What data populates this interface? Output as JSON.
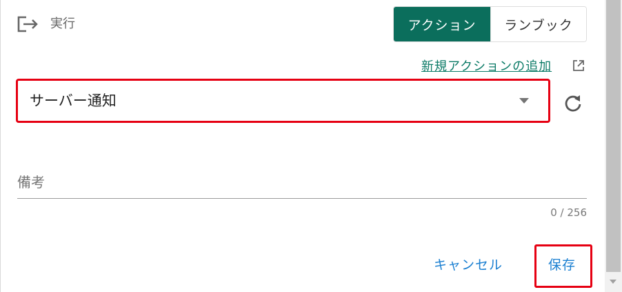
{
  "header": {
    "exec_label": "実行",
    "tabs": [
      {
        "label": "アクション",
        "active": true
      },
      {
        "label": "ランブック",
        "active": false
      }
    ]
  },
  "add_action_link": "新規アクションの追加",
  "action_select": {
    "value": "サーバー通知"
  },
  "remarks": {
    "label": "備考",
    "counter": "0 / 256"
  },
  "footer": {
    "cancel_label": "キャンセル",
    "save_label": "保存"
  },
  "colors": {
    "accent_green": "#0b6e5c",
    "link_green": "#0b7a66",
    "button_blue": "#1a7fd1",
    "highlight_red": "#e60012"
  },
  "icons": {
    "exec": "logout-arrow-icon",
    "external": "open-in-new-icon",
    "dropdown": "caret-down-icon",
    "refresh": "refresh-icon"
  }
}
